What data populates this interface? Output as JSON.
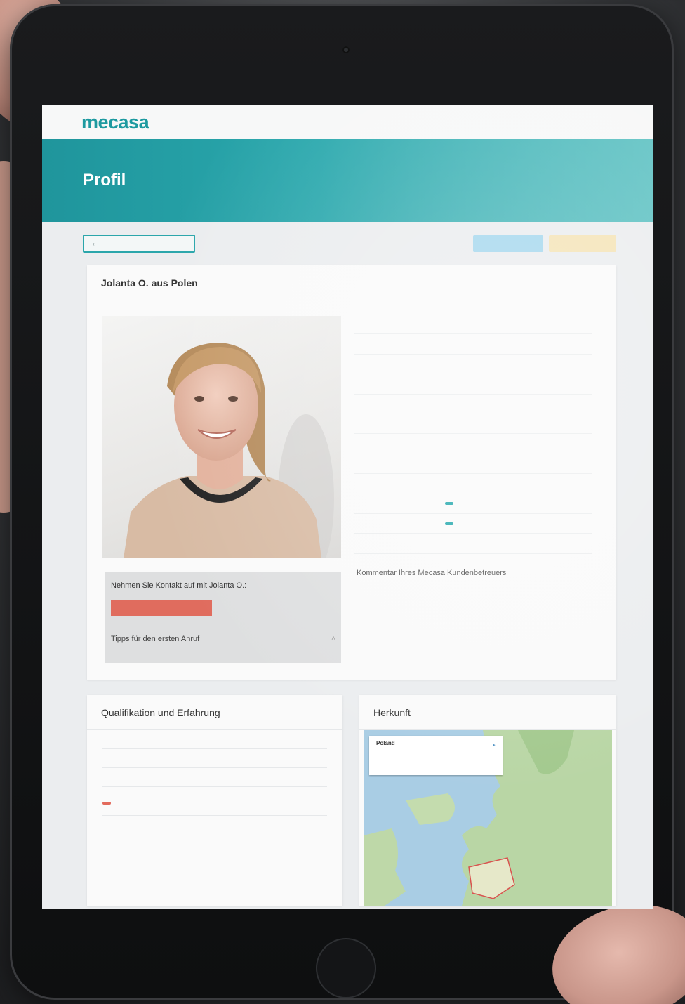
{
  "app": {
    "logo": "mecasa",
    "nav_link": "",
    "phone": ""
  },
  "hero": {
    "title": "Profil"
  },
  "actions": {
    "back_label": "",
    "primary_label": ""
  },
  "profile": {
    "name_title": "Jolanta O. aus Polen",
    "contact_title": "Nehmen Sie Kontakt auf mit Jolanta O.:",
    "phone_button": "",
    "tips_label": "Tipps für den ersten Anruf",
    "details": [
      {
        "label": "",
        "value": ""
      },
      {
        "label": "",
        "value": ""
      },
      {
        "label": "",
        "value": ""
      },
      {
        "label": "",
        "value": ""
      },
      {
        "label": "",
        "value": ""
      },
      {
        "label": "",
        "value": ""
      },
      {
        "label": "",
        "value": ""
      },
      {
        "label": "",
        "value": ""
      },
      {
        "label": "",
        "value": ""
      },
      {
        "label": "",
        "value": ""
      },
      {
        "label": "",
        "value": ""
      },
      {
        "label": "",
        "value": ""
      }
    ],
    "comment_title": "Kommentar Ihres Mecasa Kundenbetreuers",
    "comment_text": ""
  },
  "qualification": {
    "title": "Qualifikation und Erfahrung",
    "items": [
      {
        "label": "",
        "value": ""
      },
      {
        "label": "",
        "value": ""
      },
      {
        "label": "",
        "value": ""
      },
      {
        "label": "",
        "value": ""
      },
      {
        "label": "",
        "value": ""
      }
    ]
  },
  "origin": {
    "title": "Herkunft",
    "map_info_title": "Poland",
    "map_labels": []
  },
  "colors": {
    "brand_teal": "#1d9aa0",
    "accent_red": "#e06c5e"
  }
}
